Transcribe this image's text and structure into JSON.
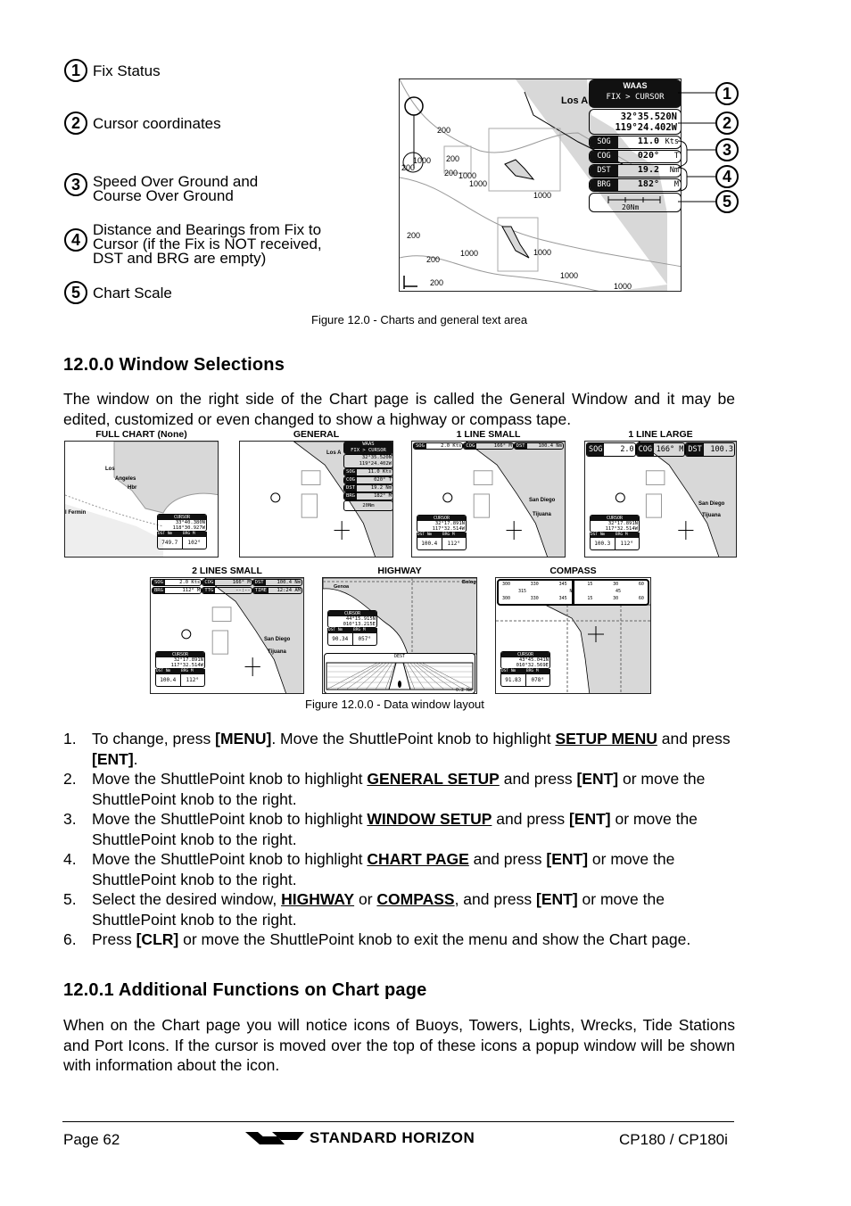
{
  "figure1": {
    "callouts": [
      {
        "num": "1",
        "lines": [
          "Fix Status"
        ]
      },
      {
        "num": "2",
        "lines": [
          "Cursor coordinates"
        ]
      },
      {
        "num": "3",
        "lines": [
          "Speed Over Ground and",
          "Course Over Ground"
        ]
      },
      {
        "num": "4",
        "lines": [
          "Distance and Bearings from Fix to",
          "Cursor (if the Fix is NOT received,",
          "DST and BRG are empty)"
        ]
      },
      {
        "num": "5",
        "lines": [
          "Chart Scale"
        ]
      }
    ],
    "screen": {
      "fix_source": "WAAS",
      "mode": "FIX > CURSOR",
      "lat": "32°35.520N",
      "lon": "119°24.402W",
      "rows": [
        {
          "label": "SOG",
          "value": "11.0",
          "unit": "Kts"
        },
        {
          "label": "COG",
          "value": "020°",
          "unit": "T"
        },
        {
          "label": "DST",
          "value": "19.2",
          "unit": "Nm"
        },
        {
          "label": "BRG",
          "value": "182°",
          "unit": "M"
        }
      ],
      "scale": "20Nm",
      "place_label": "Los A",
      "depth_labels": [
        "200",
        "200",
        "200",
        "1000",
        "200",
        "1000",
        "1000",
        "1000",
        "1000",
        "200",
        "200",
        "1000",
        "200",
        "1000",
        "1000"
      ]
    },
    "marker_nums": [
      "1",
      "2",
      "3",
      "4",
      "5"
    ],
    "caption": "Figure 12.0  - Charts and general text area"
  },
  "section1": {
    "title": "12.0.0  Window Selections",
    "paragraph": "The window on the right side of the Chart page is called the General Window and it may be edited, customized or even changed to show a highway or compass tape."
  },
  "figure2": {
    "panels": {
      "full_chart": {
        "label": "FULL CHART (None)",
        "places": [
          "Los",
          "Angeles",
          "Hbr",
          "l Fermin"
        ],
        "cursor_title": "CURSOR",
        "lat": "33°40.380N",
        "lon": "118°30.927W",
        "dst_label": "DST",
        "dst_unit": "Nm",
        "brg_label": "BRG",
        "brg_unit": "M",
        "dst": "749.7",
        "brg": "102°"
      },
      "general": {
        "label": "GENERAL",
        "fix_source": "WAAS",
        "mode": "FIX > CURSOR",
        "lat": "32°35.520N",
        "lon": "119°24.402W",
        "rows": [
          [
            "SOG",
            "11.0 Kts"
          ],
          [
            "COG",
            "020° T"
          ],
          [
            "DST",
            "19.2 Nm"
          ],
          [
            "BRG",
            "182° M"
          ]
        ],
        "scale": "20Nm",
        "place": "Los A"
      },
      "one_line_small": {
        "label": "1 LINE SMALL",
        "bar": [
          [
            "SOG",
            "2.0 Kts"
          ],
          [
            "COG",
            "166° M"
          ],
          [
            "DST",
            "100.4 Nm"
          ]
        ],
        "places": [
          "San Diego",
          "Tijuana"
        ],
        "cursor_title": "CURSOR",
        "lat": "32°17.891N",
        "lon": "117°32.514W",
        "dst": "100.4",
        "brg": "112°"
      },
      "one_line_large": {
        "label": "1 LINE LARGE",
        "bar": [
          [
            "SOG",
            "2.0 Kts"
          ],
          [
            "COG",
            "166° M"
          ],
          [
            "DST",
            "100.3 Nm"
          ]
        ],
        "places": [
          "San Diego",
          "Tijuana"
        ],
        "cursor_title": "CURSOR",
        "lat": "32°17.891N",
        "lon": "117°32.514W",
        "dst": "100.3",
        "brg": "112°"
      },
      "two_lines_small": {
        "label": "2 LINES SMALL",
        "bar1": [
          [
            "SOG",
            "2.0 Kts"
          ],
          [
            "COG",
            "166° M"
          ],
          [
            "DST",
            "100.4 Nm"
          ]
        ],
        "bar2": [
          [
            "BRG",
            "112° M"
          ],
          [
            "TTG",
            "--:--"
          ],
          [
            "TIME",
            "12:24 AM"
          ]
        ],
        "places": [
          "San Diego",
          "Tijuana"
        ],
        "cursor_title": "CURSOR",
        "lat": "32°17.891N",
        "lon": "117°32.514W",
        "dst": "100.4",
        "brg": "112°"
      },
      "highway": {
        "label": "HIGHWAY",
        "places": [
          "Genoa",
          "Bologn"
        ],
        "cursor_title": "CURSOR",
        "lat": "44°15.915N",
        "lon": "010°13.215E",
        "dst": "90.34",
        "brg": "057°",
        "dest_label": "DEST",
        "scale": "0.2 Nm"
      },
      "compass": {
        "label": "COMPASS",
        "ticks_top": [
          "300",
          "330",
          "345",
          "15",
          "30",
          "60"
        ],
        "mid": [
          "315",
          "N",
          "45"
        ],
        "ticks_bottom": [
          "300",
          "330",
          "345",
          "15",
          "30",
          "60"
        ],
        "cursor_title": "CURSOR",
        "lat": "43°45.041N",
        "lon": "010°32.569E",
        "dst": "91.83",
        "brg": "078°"
      }
    },
    "col_labels": {
      "dst": "DST",
      "dst_unit": "Nm",
      "brg": "BRG",
      "brg_unit": "M"
    },
    "caption": "Figure 12.0.0 - Data window layout"
  },
  "steps": [
    {
      "n": "1.",
      "parts": [
        [
          "t",
          "To change, press  "
        ],
        [
          "b",
          "[MENU]"
        ],
        [
          "t",
          ". Move the ShuttlePoint knob to highlight "
        ],
        [
          "u",
          "SETUP MENU"
        ],
        [
          "t",
          " and press "
        ],
        [
          "b",
          "[ENT]"
        ],
        [
          "t",
          "."
        ]
      ]
    },
    {
      "n": "2.",
      "parts": [
        [
          "t",
          "Move the ShuttlePoint knob to highlight "
        ],
        [
          "u",
          "GENERAL SETUP"
        ],
        [
          "t",
          " and press "
        ],
        [
          "b",
          "[ENT]"
        ],
        [
          "t",
          " or move the ShuttlePoint knob to the right."
        ]
      ]
    },
    {
      "n": "3.",
      "parts": [
        [
          "t",
          "Move the ShuttlePoint knob to highlight "
        ],
        [
          "u",
          "WINDOW SETUP"
        ],
        [
          "t",
          " and press "
        ],
        [
          "b",
          "[ENT]"
        ],
        [
          "t",
          " or move the ShuttlePoint knob to the right."
        ]
      ]
    },
    {
      "n": "4.",
      "parts": [
        [
          "t",
          "Move the ShuttlePoint knob to highlight "
        ],
        [
          "u",
          "CHART PAGE"
        ],
        [
          "t",
          " and press "
        ],
        [
          "b",
          "[ENT]"
        ],
        [
          "t",
          " or move the ShuttlePoint knob to the right."
        ]
      ]
    },
    {
      "n": "5.",
      "parts": [
        [
          "t",
          "Select the desired window, "
        ],
        [
          "u",
          "HIGHWAY"
        ],
        [
          "t",
          " or "
        ],
        [
          "u",
          "COMPASS"
        ],
        [
          "t",
          ", and press "
        ],
        [
          "b",
          "[ENT]"
        ],
        [
          "t",
          " or move the ShuttlePoint knob to the right."
        ]
      ]
    },
    {
      "n": "6.",
      "parts": [
        [
          "t",
          "Press "
        ],
        [
          "b",
          "[CLR]"
        ],
        [
          "t",
          " or move the ShuttlePoint knob to exit the menu and show the Chart page."
        ]
      ]
    }
  ],
  "section2": {
    "title": "12.0.1  Additional Functions on Chart page",
    "paragraph": "When on the Chart page you will notice icons of Buoys, Towers, Lights, Wrecks, Tide Stations and Port Icons. If the cursor is moved over the top of these icons a popup window will be shown with information about the icon."
  },
  "footer": {
    "page": "Page  62",
    "brand": "STANDARD HORIZON",
    "model": "CP180 / CP180i"
  }
}
